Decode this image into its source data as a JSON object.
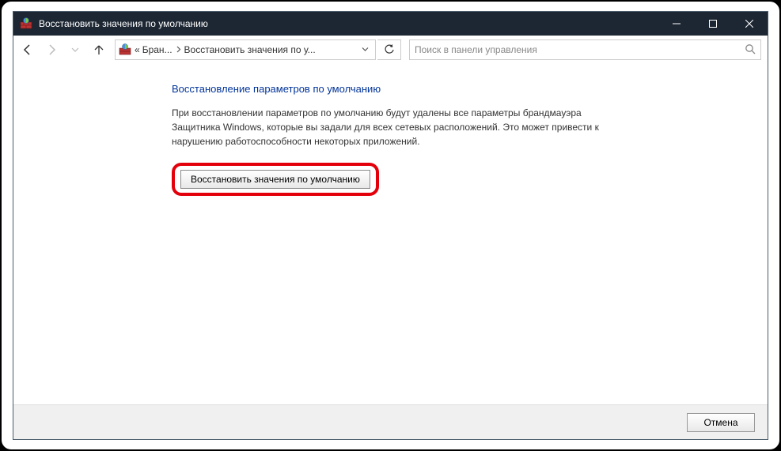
{
  "window": {
    "title": "Восстановить значения по умолчанию"
  },
  "breadcrumb": {
    "prefix": "«",
    "crumb1": "Бран...",
    "crumb2": "Восстановить значения по у..."
  },
  "search": {
    "placeholder": "Поиск в панели управления"
  },
  "main": {
    "heading": "Восстановление параметров по умолчанию",
    "description": "При восстановлении параметров по умолчанию будут удалены все параметры брандмауэра Защитника Windows, которые вы задали для всех сетевых расположений. Это может привести к нарушению работоспособности некоторых приложений.",
    "restore_button": "Восстановить значения по умолчанию"
  },
  "footer": {
    "cancel": "Отмена"
  }
}
